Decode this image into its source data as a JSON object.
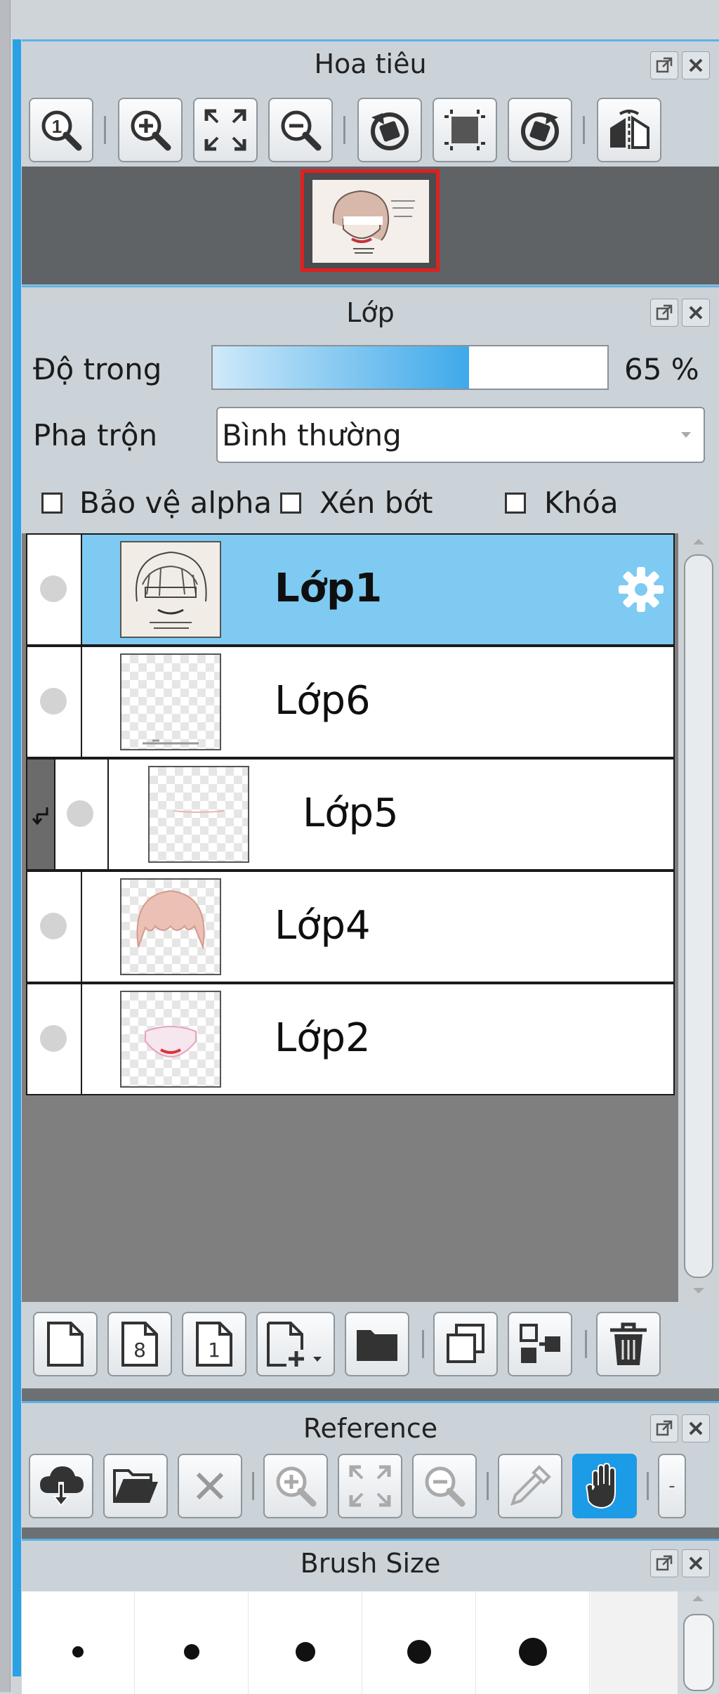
{
  "navigator": {
    "title": "Hoa tiêu",
    "toolbar": [
      "zoom-actual-size",
      "zoom-in",
      "fit-window",
      "zoom-out",
      "rotate-left",
      "fit-canvas",
      "rotate-right",
      "flip-horizontal"
    ]
  },
  "layer_panel": {
    "title": "Lớp",
    "opacity_label": "Độ trong",
    "opacity_value": 65,
    "opacity_text": "65 %",
    "blend_label": "Pha trộn",
    "blend_value": "Bình thường",
    "checkboxes": {
      "alpha_protect": "Bảo vệ alpha",
      "clipping": "Xén bớt",
      "lock": "Khóa"
    },
    "layers": [
      {
        "name": "Lớp1",
        "selected": true,
        "clipped": false
      },
      {
        "name": "Lớp6",
        "selected": false,
        "clipped": false
      },
      {
        "name": "Lớp5",
        "selected": false,
        "clipped": true
      },
      {
        "name": "Lớp4",
        "selected": false,
        "clipped": false
      },
      {
        "name": "Lớp2",
        "selected": false,
        "clipped": false
      }
    ],
    "bottom_toolbar": [
      "new-layer",
      "new-8bit-layer",
      "new-1bit-layer",
      "add-layer-menu",
      "new-folder",
      "duplicate-layer",
      "merge-down",
      "delete-layer"
    ],
    "new_8bit_text": "8",
    "new_1bit_text": "1"
  },
  "reference": {
    "title": "Reference",
    "toolbar": [
      "load-cloud",
      "open-file",
      "close",
      "zoom-in",
      "fit-window",
      "zoom-out",
      "eyedropper",
      "hand"
    ],
    "active_tool": "hand",
    "active_color": "#1c9be6",
    "overflow_text": "-"
  },
  "brush_size": {
    "title": "Brush Size",
    "dots": [
      1,
      2,
      3,
      4,
      5
    ]
  },
  "colors": {
    "accent": "#2aa1e4",
    "selected_row": "#7fcaf2"
  }
}
